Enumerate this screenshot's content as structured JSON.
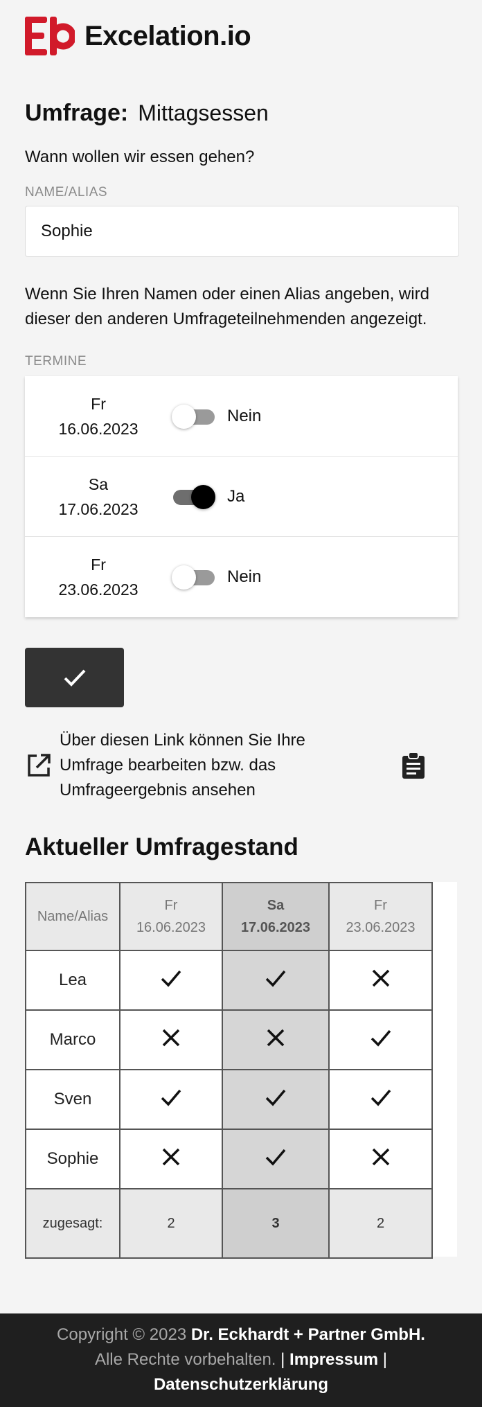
{
  "header": {
    "brand": "Excelation.io",
    "logo_icon": "excelation-logo-icon",
    "brand_color": "#d11a2a"
  },
  "survey": {
    "title_label": "Umfrage:",
    "title_value": "Mittagsessen",
    "question": "Wann wollen wir essen gehen?"
  },
  "name_field": {
    "label": "NAME/ALIAS",
    "value": "Sophie"
  },
  "hint": "Wenn Sie Ihren Namen oder einen Alias angeben, wird dieser den anderen Umfrageteilnehmenden angezeigt.",
  "dates": {
    "label": "TERMINE",
    "items": [
      {
        "day": "Fr",
        "date": "16.06.2023",
        "state": "Nein",
        "on": false
      },
      {
        "day": "Sa",
        "date": "17.06.2023",
        "state": "Ja",
        "on": true
      },
      {
        "day": "Fr",
        "date": "23.06.2023",
        "state": "Nein",
        "on": false
      }
    ]
  },
  "submit": {
    "icon": "check-icon"
  },
  "edit_link": {
    "text": "Über diesen Link können Sie Ihre Umfrage bearbeiten bzw. das Umfrageergebnis ansehen",
    "icon": "external-link-icon",
    "copy_icon": "clipboard-icon"
  },
  "results": {
    "title": "Aktueller Umfragestand",
    "header_name": "Name/Alias",
    "columns": [
      {
        "day": "Fr",
        "date": "16.06.2023"
      },
      {
        "day": "Sa",
        "date": "17.06.2023"
      },
      {
        "day": "Fr",
        "date": "23.06.2023"
      }
    ],
    "rows": [
      {
        "name": "Lea",
        "votes": [
          "yes",
          "yes",
          "no"
        ]
      },
      {
        "name": "Marco",
        "votes": [
          "no",
          "no",
          "yes"
        ]
      },
      {
        "name": "Sven",
        "votes": [
          "yes",
          "yes",
          "yes"
        ]
      },
      {
        "name": "Sophie",
        "votes": [
          "no",
          "yes",
          "no"
        ]
      }
    ],
    "sum_label": "zugesagt:",
    "sums": [
      "2",
      "3",
      "2"
    ]
  },
  "footer": {
    "copyright": "Copyright © 2023",
    "company": "Dr. Eckhardt + Partner GmbH.",
    "rights": "Alle Rechte vorbehalten.",
    "impressum": "Impressum",
    "privacy": "Datenschutzerklärung"
  }
}
